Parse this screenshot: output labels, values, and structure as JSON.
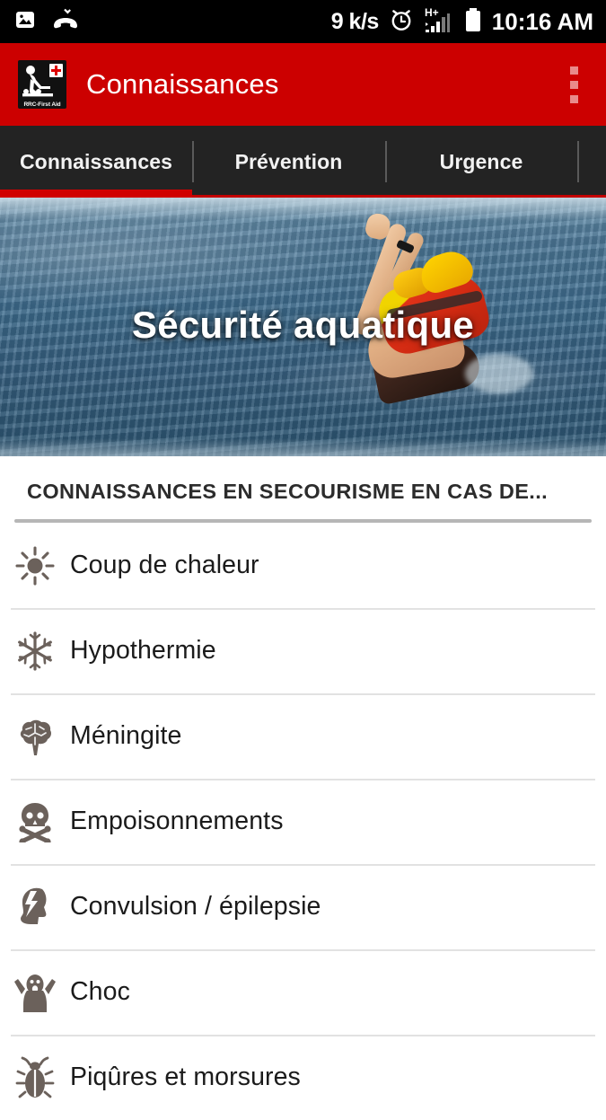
{
  "statusbar": {
    "icons_left": [
      "image-icon",
      "missed-call-icon"
    ],
    "network_speed": "9 k/s",
    "icons_right": [
      "alarm-clock-icon",
      "signal-hplus-icon",
      "battery-icon"
    ],
    "clock": "10:16 AM"
  },
  "appbar": {
    "logo_caption": "RRC-First Aid",
    "logo_icon": "cpr-first-aid-logo",
    "title": "Connaissances",
    "overflow_icon": "overflow-menu-icon",
    "bg_color": "#cc0000"
  },
  "tabs": {
    "active_index": 0,
    "items": [
      {
        "label": "Connaissances"
      },
      {
        "label": "Prévention"
      },
      {
        "label": "Urgence"
      },
      {
        "label": ""
      }
    ],
    "indicator_color": "#d00000",
    "bg_color": "#232323"
  },
  "hero": {
    "title": "Sécurité aquatique",
    "image_description": "lifeguard-in-water-photo"
  },
  "section": {
    "title": "CONNAISSANCES EN SECOURISME EN CAS DE..."
  },
  "list": {
    "items": [
      {
        "label": "Coup de chaleur",
        "icon": "sun-icon"
      },
      {
        "label": "Hypothermie",
        "icon": "snowflake-icon"
      },
      {
        "label": "Méningite",
        "icon": "brain-icon"
      },
      {
        "label": "Empoisonnements",
        "icon": "skull-crossbones-icon"
      },
      {
        "label": "Convulsion / épilepsie",
        "icon": "head-lightning-icon"
      },
      {
        "label": "Choc",
        "icon": "shocked-person-icon"
      },
      {
        "label": "Piqûres et morsures",
        "icon": "insect-bug-icon"
      }
    ],
    "icon_color": "#6b615b"
  }
}
